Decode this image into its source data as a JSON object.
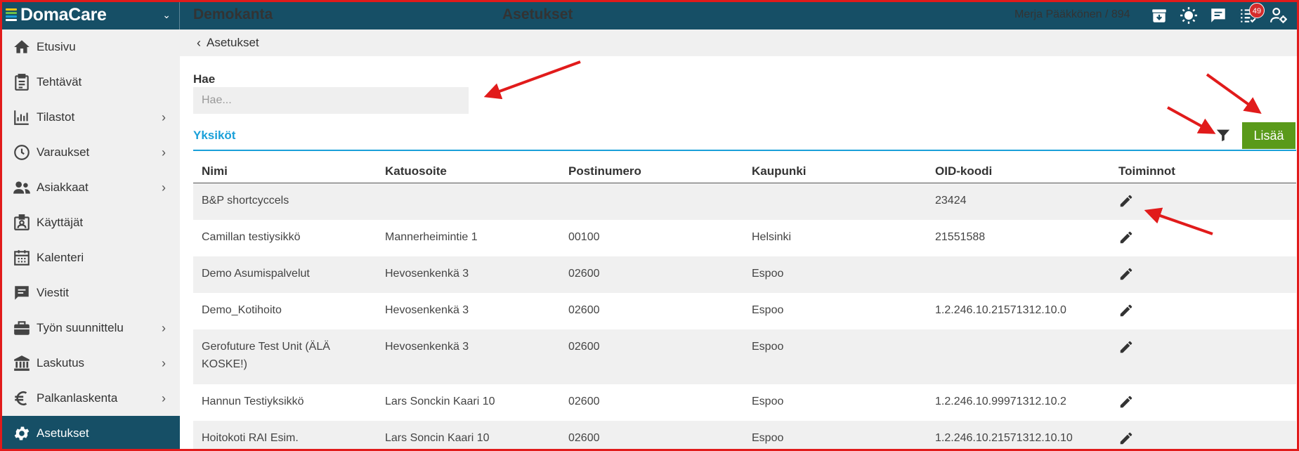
{
  "brand": {
    "name": "DomaCare",
    "logo_colors": [
      "#f5c518",
      "#6cc04a",
      "#1aa0d9",
      "#ffffff"
    ]
  },
  "header": {
    "org": "Demokanta",
    "title": "Asetukset",
    "user": "Merja Pääkkönen / 894",
    "notification_count": "49",
    "icons": [
      "archive-icon",
      "sun-icon",
      "chat-icon",
      "task-list-icon",
      "user-settings-icon"
    ]
  },
  "sidebar": {
    "items": [
      {
        "label": "Etusivu",
        "icon": "home-icon",
        "has_submenu": false
      },
      {
        "label": "Tehtävät",
        "icon": "clipboard-icon",
        "has_submenu": false
      },
      {
        "label": "Tilastot",
        "icon": "stats-icon",
        "has_submenu": true
      },
      {
        "label": "Varaukset",
        "icon": "clock-icon",
        "has_submenu": true
      },
      {
        "label": "Asiakkaat",
        "icon": "people-icon",
        "has_submenu": true
      },
      {
        "label": "Käyttäjät",
        "icon": "id-card-icon",
        "has_submenu": false
      },
      {
        "label": "Kalenteri",
        "icon": "calendar-icon",
        "has_submenu": false
      },
      {
        "label": "Viestit",
        "icon": "message-icon",
        "has_submenu": false
      },
      {
        "label": "Työn suunnittelu",
        "icon": "briefcase-icon",
        "has_submenu": true
      },
      {
        "label": "Laskutus",
        "icon": "bank-icon",
        "has_submenu": true
      },
      {
        "label": "Palkanlaskenta",
        "icon": "euro-icon",
        "has_submenu": true
      },
      {
        "label": "Asetukset",
        "icon": "gear-icon",
        "has_submenu": false,
        "active": true
      }
    ],
    "active_color": "#164f66"
  },
  "breadcrumb": {
    "back_label": "Asetukset"
  },
  "search": {
    "label": "Hae",
    "placeholder": "Hae...",
    "value": ""
  },
  "tab": {
    "label": "Yksiköt",
    "color": "#1aa0d9"
  },
  "toolbar": {
    "add_label": "Lisää",
    "add_color": "#5a9a1a"
  },
  "table": {
    "columns": [
      "Nimi",
      "Katuosoite",
      "Postinumero",
      "Kaupunki",
      "OID-koodi",
      "Toiminnot"
    ],
    "rows": [
      {
        "name": "B&P shortcyccels",
        "street": "",
        "postal": "",
        "city": "",
        "oid": "23424"
      },
      {
        "name": "Camillan testiysikkö",
        "street": "Mannerheimintie 1",
        "postal": "00100",
        "city": "Helsinki",
        "oid": "21551588"
      },
      {
        "name": "Demo Asumispalvelut",
        "street": "Hevosenkenkä 3",
        "postal": "02600",
        "city": "Espoo",
        "oid": ""
      },
      {
        "name": "Demo_Kotihoito",
        "street": "Hevosenkenkä 3",
        "postal": "02600",
        "city": "Espoo",
        "oid": "1.2.246.10.21571312.10.0"
      },
      {
        "name": "Gerofuture Test Unit (ÄLÄ KOSKE!)",
        "street": "Hevosenkenkä 3",
        "postal": "02600",
        "city": "Espoo",
        "oid": ""
      },
      {
        "name": "Hannun Testiyksikkö",
        "street": "Lars Sonckin Kaari 10",
        "postal": "02600",
        "city": "Espoo",
        "oid": "1.2.246.10.99971312.10.2"
      },
      {
        "name": "Hoitokoti RAI Esim.",
        "street": "Lars Soncin Kaari 10",
        "postal": "02600",
        "city": "Espoo",
        "oid": "1.2.246.10.21571312.10.10"
      }
    ]
  }
}
